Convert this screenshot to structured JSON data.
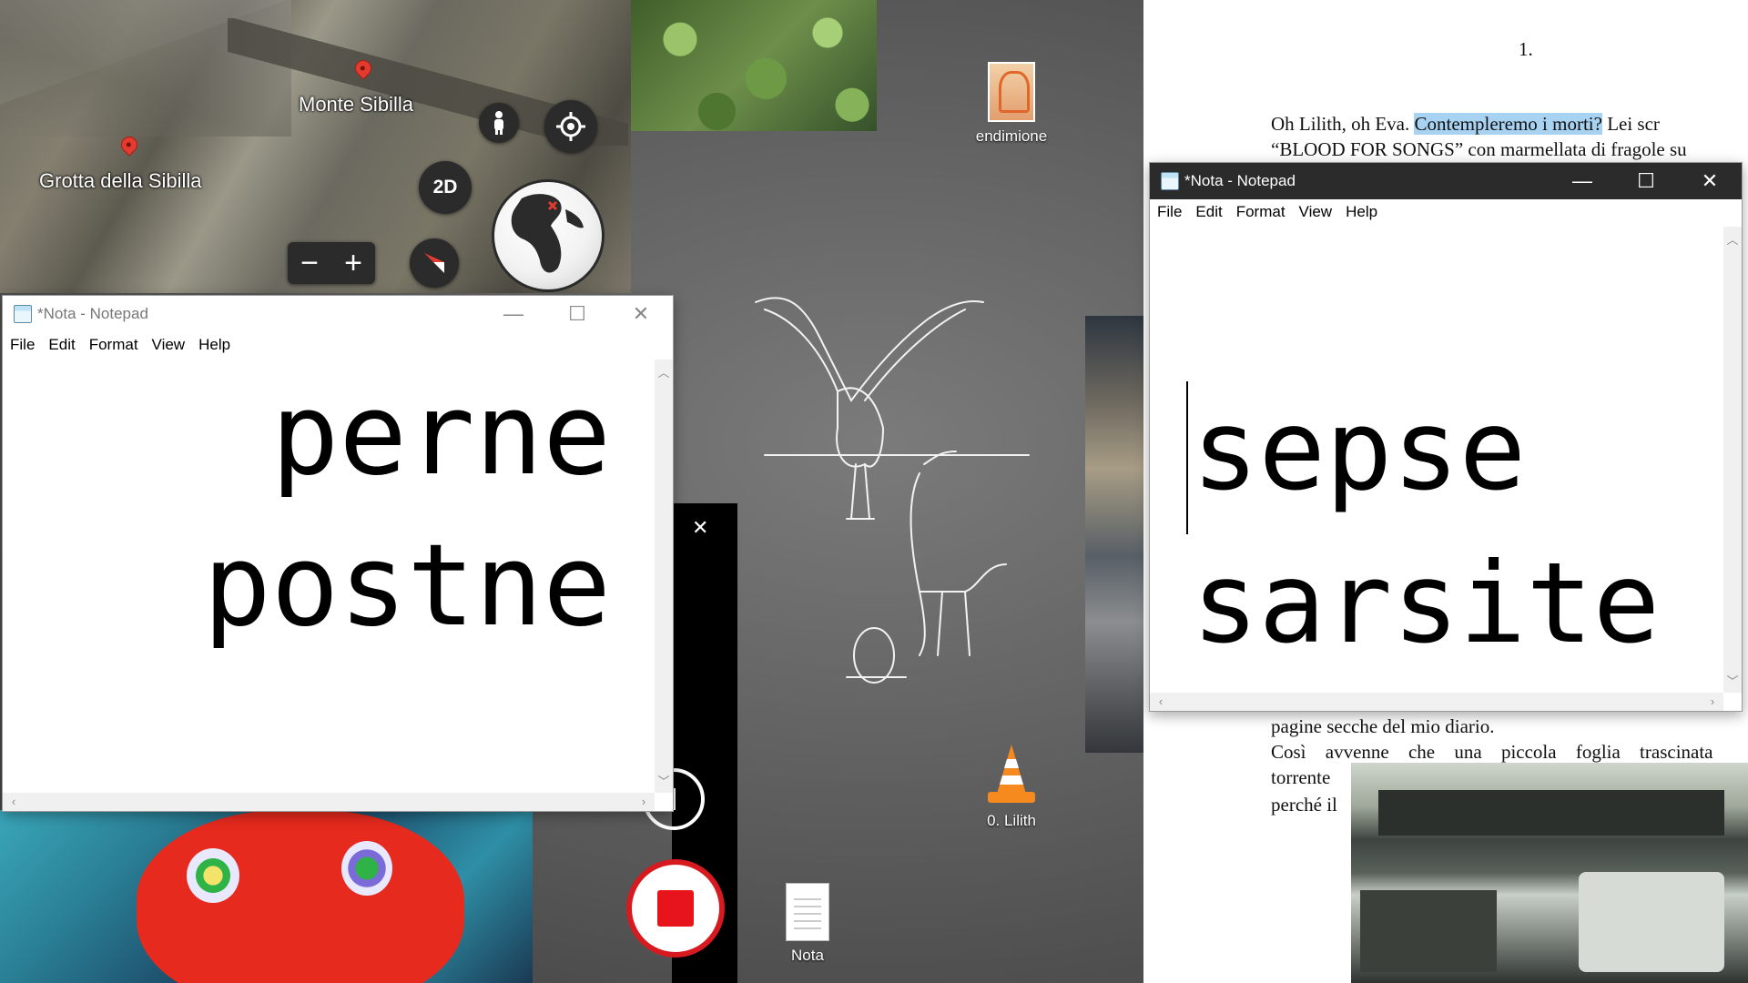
{
  "map": {
    "labels": {
      "monte": "Monte Sibilla",
      "grotta": "Grotta della Sibilla"
    },
    "buttons": {
      "mode_2d": "2D",
      "zoom_out": "−",
      "zoom_in": "+"
    }
  },
  "notepad_left": {
    "title": "*Nota - Notepad",
    "menu": [
      "File",
      "Edit",
      "Format",
      "View",
      "Help"
    ],
    "lines": [
      "perne",
      "postne"
    ],
    "controls": {
      "minimize": "—",
      "maximize": "☐",
      "close": "✕"
    }
  },
  "notepad_right": {
    "title": "*Nota - Notepad",
    "menu": [
      "File",
      "Edit",
      "Format",
      "View",
      "Help"
    ],
    "lines": [
      "sepse",
      "sarsite"
    ],
    "controls": {
      "minimize": "—",
      "maximize": "☐",
      "close": "✕"
    }
  },
  "desktop_icons": {
    "endimione": "endimione",
    "lilith": "0. Lilith",
    "nota": "Nota"
  },
  "document": {
    "page_number": "1.",
    "line1_a": "Oh Lilith, oh Eva. ",
    "line1_highlight": "Contempleremo i morti?",
    "line1_b": " Lei scr",
    "line2": "“BLOOD FOR SONGS” con marmellata di fragole su",
    "line3": "pagine secche del mio diario.",
    "line4": "Così avvenne che una piccola foglia trascinata",
    "line5": "torrente",
    "line6": "perché il"
  },
  "recorder": {
    "close": "✕"
  }
}
